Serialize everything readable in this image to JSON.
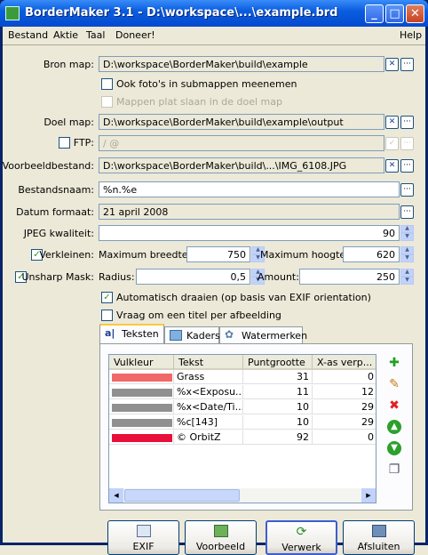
{
  "window": {
    "title": "BorderMaker 3.1 - D:\\workspace\\...\\example.brd"
  },
  "menu": {
    "bestand": "Bestand",
    "aktie": "Aktie",
    "taal": "Taal",
    "doneer": "Doneer!",
    "help": "Help"
  },
  "form": {
    "bron_label": "Bron map:",
    "bron_value": "D:\\workspace\\BorderMaker\\build\\example",
    "sub_label": "Ook foto's in submappen meenemen",
    "flat_label": "Mappen plat slaan in de doel map",
    "doel_label": "Doel map:",
    "doel_value": "D:\\workspace\\BorderMaker\\build\\example\\output",
    "ftp_label": "FTP:",
    "ftp_value": "/ @",
    "voorbeeld_label": "Voorbeeldbestand:",
    "voorbeeld_value": "D:\\workspace\\BorderMaker\\build\\...\\IMG_6108.JPG",
    "naam_label": "Bestandsnaam:",
    "naam_value": "%n.%e",
    "datum_label": "Datum formaat:",
    "datum_value": "21 april 2008",
    "jpeg_label": "JPEG kwaliteit:",
    "jpeg_value": "90",
    "verkleinen_label": "Verkleinen:",
    "max_breedte_label": "Maximum breedte:",
    "max_breedte_value": "750",
    "max_hoogte_label": "Maximum hoogte:",
    "max_hoogte_value": "620",
    "unsharp_label": "Unsharp Mask:",
    "radius_label": "Radius:",
    "radius_value": "0,5",
    "amount_label": "Amount:",
    "amount_value": "250",
    "auto_label": "Automatisch draaien (op basis van EXIF orientation)",
    "titel_label": "Vraag om een titel per afbeelding"
  },
  "tabs": [
    "Teksten",
    "Kaders",
    "Watermerken"
  ],
  "table": {
    "headers": [
      "Vulkleur",
      "Tekst",
      "Puntgrootte",
      "X-as verp..."
    ],
    "rows": [
      {
        "color": "#f06868",
        "text": "Grass",
        "size": "31",
        "x": "0"
      },
      {
        "color": "#909090",
        "text": "%x<Exposu...",
        "size": "11",
        "x": "12"
      },
      {
        "color": "#909090",
        "text": "%x<Date/Ti...",
        "size": "10",
        "x": "29"
      },
      {
        "color": "#909090",
        "text": "%c[143]",
        "size": "10",
        "x": "29"
      },
      {
        "color": "#e8103a",
        "text": "© OrbitZ",
        "size": "92",
        "x": "0"
      }
    ]
  },
  "buttons": {
    "exif": "EXIF",
    "voorbeeld": "Voorbeeld",
    "verwerk": "Verwerk",
    "afsluiten": "Afsluiten"
  }
}
